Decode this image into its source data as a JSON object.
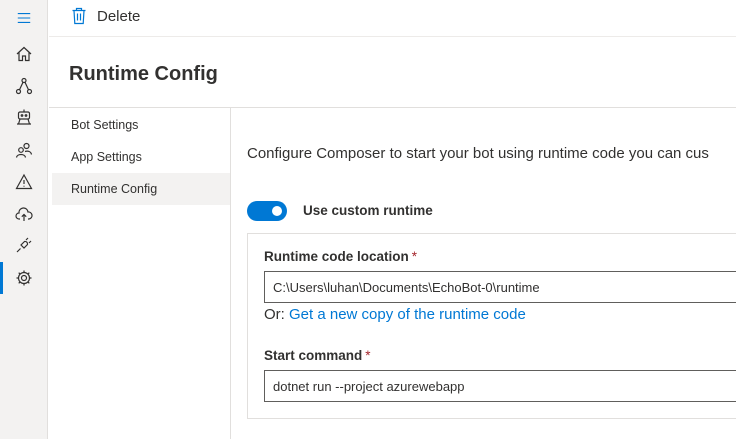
{
  "rail": {
    "items": [
      {
        "icon": "home-icon"
      },
      {
        "icon": "flow-icon"
      },
      {
        "icon": "bot-icon"
      },
      {
        "icon": "users-icon"
      },
      {
        "icon": "warning-icon"
      },
      {
        "icon": "cloud-upload-icon"
      },
      {
        "icon": "plug-icon"
      },
      {
        "icon": "settings-icon",
        "active": true
      }
    ]
  },
  "toolbar": {
    "delete_label": "Delete"
  },
  "page": {
    "title": "Runtime Config"
  },
  "nav": {
    "items": [
      {
        "label": "Bot Settings"
      },
      {
        "label": "App Settings"
      },
      {
        "label": "Runtime Config",
        "selected": true
      }
    ]
  },
  "content": {
    "description": "Configure Composer to start your bot using runtime code you can cus",
    "toggle": {
      "label": "Use custom runtime",
      "on": true
    },
    "runtime_location": {
      "label": "Runtime code location",
      "required_mark": "*",
      "value": "C:\\Users\\luhan\\Documents\\EchoBot-0\\runtime"
    },
    "or_text": "Or:",
    "copy_link": "Get a new copy of the runtime code",
    "start_command": {
      "label": "Start command",
      "required_mark": "*",
      "value": "dotnet run --project azurewebapp"
    }
  },
  "colors": {
    "accent": "#0078d4",
    "required": "#a4262c",
    "rail_bg": "#f3f2f1"
  }
}
